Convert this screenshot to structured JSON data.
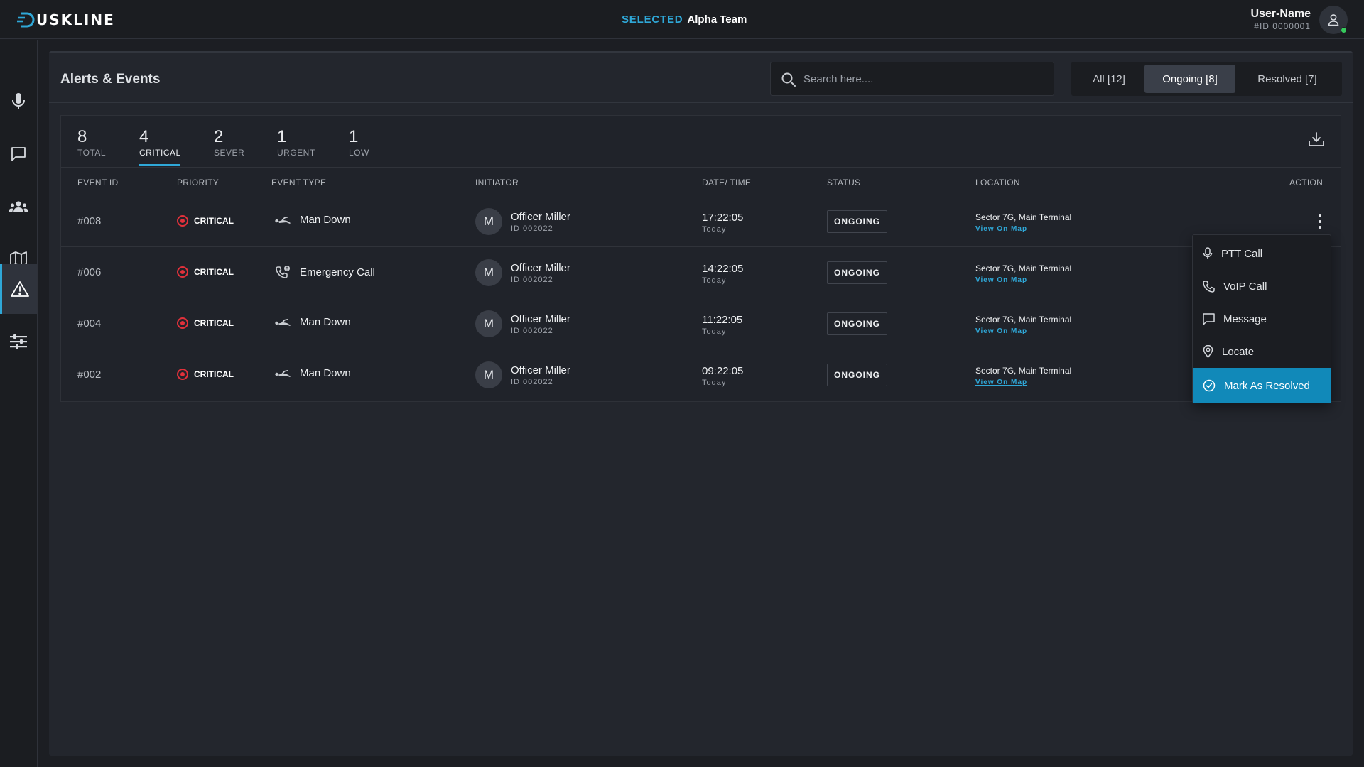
{
  "app": {
    "brand": "USKLINE",
    "selected_label": "SELECTED",
    "selected_team": "Alpha Team"
  },
  "user": {
    "name": "User-Name",
    "id": "#ID 0000001"
  },
  "sidebar": {
    "items": [
      {
        "name": "ptt",
        "icon": "microphone-icon"
      },
      {
        "name": "messages",
        "icon": "chat-icon"
      },
      {
        "name": "teams",
        "icon": "users-icon"
      },
      {
        "name": "map",
        "icon": "map-icon"
      },
      {
        "name": "alerts",
        "icon": "warning-icon",
        "active": true
      },
      {
        "name": "settings",
        "icon": "sliders-icon"
      }
    ]
  },
  "page": {
    "title": "Alerts & Events",
    "search_placeholder": "Search here....",
    "filters": [
      "All [12]",
      "Ongoing [8]",
      "Resolved [7]"
    ],
    "active_filter": "Ongoing [8]"
  },
  "stats": [
    {
      "value": "8",
      "label": "TOTAL"
    },
    {
      "value": "4",
      "label": "CRITICAL",
      "active": true
    },
    {
      "value": "2",
      "label": "SEVER"
    },
    {
      "value": "1",
      "label": "URGENT"
    },
    {
      "value": "1",
      "label": "LOW"
    }
  ],
  "table": {
    "columns": [
      "EVENT ID",
      "PRIORITY",
      "EVENT TYPE",
      "INITIATOR",
      "DATE/ TIME",
      "STATUS",
      "LOCATION",
      "ACTION"
    ],
    "rows": [
      {
        "id": "#008",
        "priority": "CRITICAL",
        "type": "Man Down",
        "type_icon": "man-down-icon",
        "initial": "M",
        "initiator": "Officer Miller",
        "initiator_id": "ID 002022",
        "time": "17:22:05",
        "day": "Today",
        "status": "ONGOING",
        "location": "Sector 7G, Main Terminal",
        "map_link": "View On Map"
      },
      {
        "id": "#006",
        "priority": "CRITICAL",
        "type": "Emergency Call",
        "type_icon": "emergency-call-icon",
        "initial": "M",
        "initiator": "Officer Miller",
        "initiator_id": "ID 002022",
        "time": "14:22:05",
        "day": "Today",
        "status": "ONGOING",
        "location": "Sector 7G, Main Terminal",
        "map_link": "View On Map"
      },
      {
        "id": "#004",
        "priority": "CRITICAL",
        "type": "Man Down",
        "type_icon": "man-down-icon",
        "initial": "M",
        "initiator": "Officer Miller",
        "initiator_id": "ID 002022",
        "time": "11:22:05",
        "day": "Today",
        "status": "ONGOING",
        "location": "Sector 7G, Main Terminal",
        "map_link": "View On Map"
      },
      {
        "id": "#002",
        "priority": "CRITICAL",
        "type": "Man Down",
        "type_icon": "man-down-icon",
        "initial": "M",
        "initiator": "Officer Miller",
        "initiator_id": "ID 002022",
        "time": "09:22:05",
        "day": "Today",
        "status": "ONGOING",
        "location": "Sector 7G, Main Terminal",
        "map_link": "View On Map"
      }
    ]
  },
  "action_menu": {
    "items": [
      "PTT Call",
      "VoIP Call",
      "Message",
      "Locate",
      "Mark As Resolved"
    ]
  },
  "colors": {
    "accent": "#2fa8d8",
    "critical": "#e2313b",
    "resolve_button": "#1189b9",
    "online": "#36c95c"
  }
}
